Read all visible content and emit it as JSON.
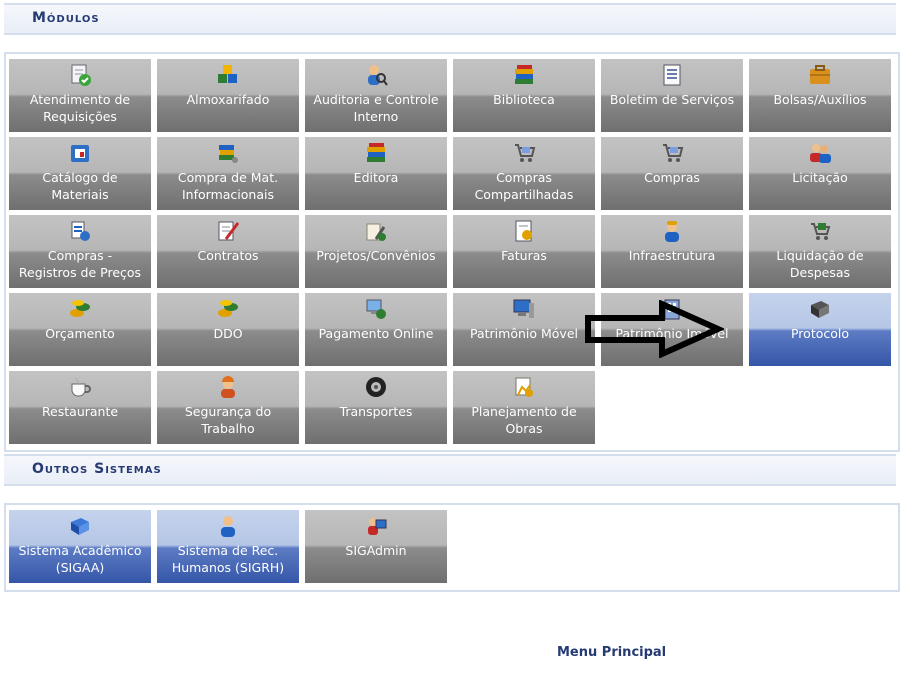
{
  "modulos": {
    "title": "Módulos",
    "tiles": [
      {
        "label": "Atendimento de\nRequisições",
        "icon": "document-check-icon"
      },
      {
        "label": "Almoxarifado",
        "icon": "cubes-icon"
      },
      {
        "label": "Auditoria e Controle\nInterno",
        "icon": "user-search-icon"
      },
      {
        "label": "Biblioteca",
        "icon": "books-icon"
      },
      {
        "label": "Boletim de Serviços",
        "icon": "document-list-icon"
      },
      {
        "label": "Bolsas/Auxílios",
        "icon": "briefcase-icon"
      },
      {
        "label": "Catálogo de\nMateriais",
        "icon": "catalog-icon"
      },
      {
        "label": "Compra de Mat.\nInformacionais",
        "icon": "books-cart-icon"
      },
      {
        "label": "Editora",
        "icon": "books-icon"
      },
      {
        "label": "Compras\nCompartilhadas",
        "icon": "cart-icon"
      },
      {
        "label": "Compras",
        "icon": "cart-icon"
      },
      {
        "label": "Licitação",
        "icon": "users-icon"
      },
      {
        "label": "Compras -\nRegistros de Preços",
        "icon": "price-register-icon"
      },
      {
        "label": "Contratos",
        "icon": "contract-pen-icon"
      },
      {
        "label": "Projetos/Convênios",
        "icon": "project-icon"
      },
      {
        "label": "Faturas",
        "icon": "invoice-icon"
      },
      {
        "label": "Infraestrutura",
        "icon": "worker-icon"
      },
      {
        "label": "Liquidação de\nDespesas",
        "icon": "cart-money-icon"
      },
      {
        "label": "Orçamento",
        "icon": "coins-icon"
      },
      {
        "label": "DDO",
        "icon": "coins-icon"
      },
      {
        "label": "Pagamento Online",
        "icon": "online-payment-icon"
      },
      {
        "label": "Patrimônio Móvel",
        "icon": "computer-icon"
      },
      {
        "label": "Patrimônio Imóvel",
        "icon": "building-icon"
      },
      {
        "label": "Protocolo",
        "icon": "book-protocol-icon",
        "active": true
      },
      {
        "label": "Restaurante",
        "icon": "coffee-cup-icon"
      },
      {
        "label": "Segurança do\nTrabalho",
        "icon": "safety-worker-icon"
      },
      {
        "label": "Transportes",
        "icon": "tire-icon"
      },
      {
        "label": "Planejamento de\nObras",
        "icon": "construction-plan-icon"
      }
    ]
  },
  "outros": {
    "title": "Outros Sistemas",
    "tiles": [
      {
        "label": "Sistema Acadêmico\n(SIGAA)",
        "icon": "blue-book-icon",
        "active": true
      },
      {
        "label": "Sistema de Rec.\nHumanos (SIGRH)",
        "icon": "person-icon",
        "active": true
      },
      {
        "label": "SIGAdmin",
        "icon": "admin-computer-icon",
        "active": false
      }
    ]
  },
  "footer": {
    "menu_principal": "Menu Principal"
  },
  "colors": {
    "header_text": "#263a74",
    "tile_gray": "#7a7a7a",
    "tile_blue": "#3556a8"
  }
}
